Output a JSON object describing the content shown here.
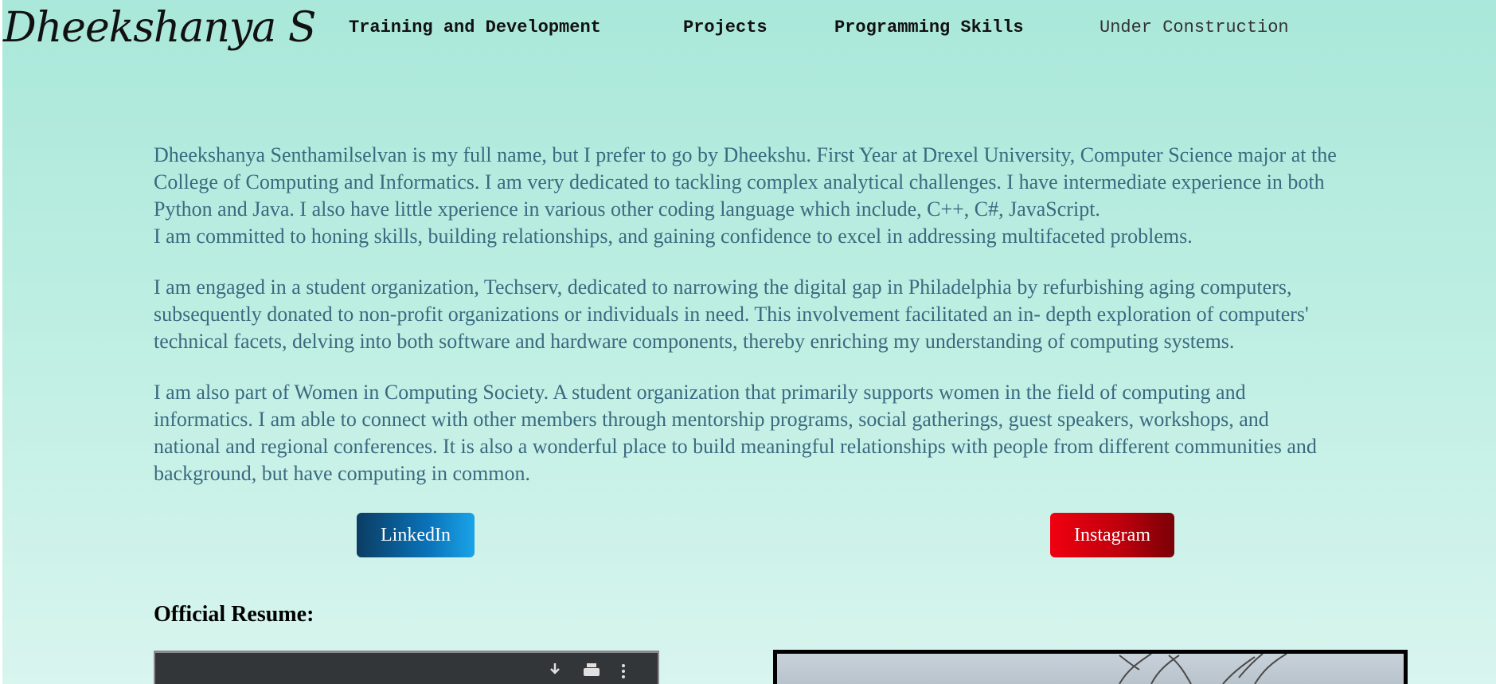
{
  "brand": {
    "name": "Dheekshanya S"
  },
  "nav": {
    "items": [
      {
        "label": "Training and Development"
      },
      {
        "label": "Projects"
      },
      {
        "label": "Programming Skills"
      },
      {
        "label": "Under Construction"
      }
    ]
  },
  "about": {
    "p1_lines": [
      "Dheekshanya Senthamilselvan is my full name, but I prefer to go by Dheekshu. First Year at Drexel University, Computer Science major at the",
      "College of Computing and Informatics. I am very dedicated to tackling complex analytical challenges. I have intermediate experience in both",
      "Python and Java. I also have little xperience in various other coding language which include, C++, C#, JavaScript.",
      "I am committed to honing skills, building relationships, and gaining confidence to excel in addressing multifaceted problems."
    ],
    "p2_lines": [
      "I am engaged in a student organization, Techserv, dedicated to narrowing the digital gap in Philadelphia by refurbishing aging computers,",
      "subsequently donated to non-profit organizations or individuals in need. This involvement facilitated an in- depth exploration of computers'",
      "technical facets, delving into both software and hardware components, thereby enriching my understanding of computing systems."
    ],
    "p3_lines": [
      "I am also part of Women in Computing Society. A student organization that primarily supports women in the field of computing and",
      "informatics. I am able to connect with other members through mentorship programs, social gatherings, guest speakers, workshops, and",
      "national and regional conferences. It is also a wonderful place to build meaningful relationships with people from different communities and",
      "background, but have computing in common."
    ]
  },
  "social": {
    "linkedin_label": "LinkedIn",
    "instagram_label": "Instagram"
  },
  "resume": {
    "heading": "Official Resume:"
  },
  "pdf_toolbar": {
    "icons": [
      "download-icon",
      "print-icon",
      "more-options-icon"
    ]
  },
  "colors": {
    "background_top": "#a9e8da",
    "body_text": "#3a6a80",
    "linkedin": "#0a72b8",
    "instagram": "#e00010"
  }
}
